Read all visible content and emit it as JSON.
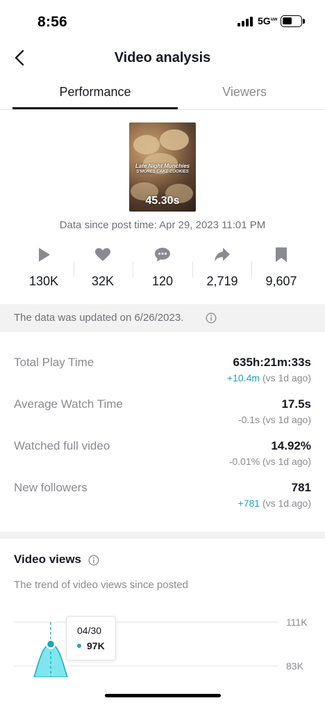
{
  "status_bar": {
    "time": "8:56",
    "network": "5G",
    "network_sup": "uw"
  },
  "nav": {
    "title": "Video analysis"
  },
  "tabs": [
    {
      "label": "Performance",
      "active": true
    },
    {
      "label": "Viewers",
      "active": false
    }
  ],
  "video": {
    "duration": "45.30s",
    "overlay_title": "Late Night Munchies",
    "overlay_sub": "S'MORES CAKE COOKIES"
  },
  "since": "Data since post time: Apr 29, 2023 11:01 PM",
  "stats": [
    {
      "icon": "play-icon",
      "value": "130K"
    },
    {
      "icon": "heart-icon",
      "value": "32K"
    },
    {
      "icon": "comment-icon",
      "value": "120"
    },
    {
      "icon": "share-icon",
      "value": "2,719"
    },
    {
      "icon": "bookmark-icon",
      "value": "9,607"
    }
  ],
  "notice": "The data was updated on 6/26/2023.",
  "metrics": [
    {
      "label": "Total Play Time",
      "value": "635h:21m:33s",
      "delta": "+10.4m",
      "suffix": " (vs 1d ago)",
      "positive": true
    },
    {
      "label": "Average Watch Time",
      "value": "17.5s",
      "delta": "-0.1s",
      "suffix": " (vs 1d ago)",
      "positive": false
    },
    {
      "label": "Watched full video",
      "value": "14.92%",
      "delta": "-0.01%",
      "suffix": " (vs 1d ago)",
      "positive": false
    },
    {
      "label": "New followers",
      "value": "781",
      "delta": "+781",
      "suffix": " (vs 1d ago)",
      "positive": true
    }
  ],
  "video_views": {
    "title": "Video views",
    "subtitle": "The trend of video views since posted"
  },
  "colors": {
    "accent": "#20a5b5",
    "text": "#161823",
    "muted": "#8a8b91",
    "area_fill": "#7fe6f0"
  },
  "chart_data": {
    "type": "area",
    "y_ticks": [
      "111K",
      "83K"
    ],
    "tick_values": [
      111000,
      83000
    ],
    "grid": true,
    "tooltip": {
      "date": "04/30",
      "value": "97K"
    },
    "points": [
      {
        "x": "04/30",
        "y": 97000
      }
    ]
  }
}
